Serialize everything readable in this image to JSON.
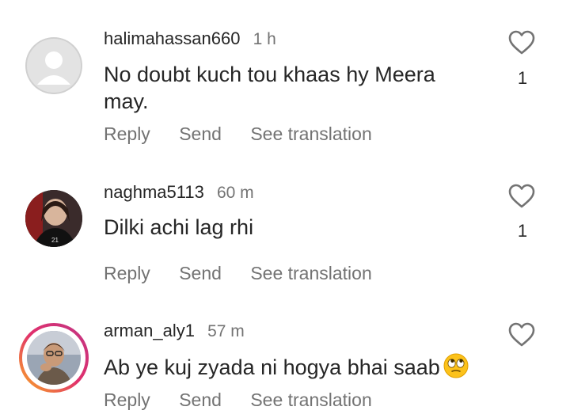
{
  "comments": [
    {
      "username": "halimahassan660",
      "time": "1 h",
      "text": "No doubt kuch tou khaas hy Meera may.",
      "actions": {
        "reply": "Reply",
        "send": "Send",
        "translate": "See translation"
      },
      "likes": "1",
      "avatar_icon": "default-avatar-icon"
    },
    {
      "username": "naghma5113",
      "time": "60 m",
      "text": "Dilki achi lag rhi",
      "actions": {
        "reply": "Reply",
        "send": "Send",
        "translate": "See translation"
      },
      "likes": "1",
      "avatar_icon": "user-photo"
    },
    {
      "username": "arman_aly1",
      "time": "57 m",
      "text": "Ab ye kuj zyada ni hogya bhai saab",
      "emoji": "face-with-rolling-eyes",
      "actions": {
        "reply": "Reply",
        "send": "Send",
        "translate": "See translation"
      },
      "likes": "",
      "avatar_icon": "user-photo-story-ring"
    }
  ],
  "colors": {
    "text": "#262626",
    "muted": "#737373",
    "story_ring_start": "#f9a825",
    "story_ring_end": "#c13584"
  }
}
